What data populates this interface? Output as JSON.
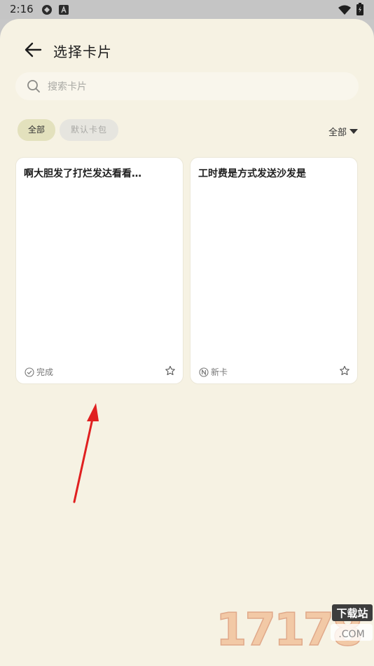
{
  "status_bar": {
    "time": "2:16"
  },
  "header": {
    "title": "选择卡片"
  },
  "search": {
    "placeholder": "搜索卡片"
  },
  "filters": {
    "chips": [
      "全部",
      "默认卡包"
    ],
    "sort_dropdown": "全部"
  },
  "cards": [
    {
      "title": "啊大胆发了打烂发达看看…",
      "status": "完成",
      "status_icon": "check-circle-icon"
    },
    {
      "title": "工时费是方式发送沙发是",
      "status": "新卡",
      "status_icon": "n-circle-icon"
    }
  ],
  "watermark": {
    "digits": "17178",
    "badge": "下载站",
    "suffix": ".COM"
  },
  "colors": {
    "background": "#f6f2e3",
    "card": "#ffffff",
    "active_chip": "#e3e1bd",
    "annotation_arrow": "#e02020"
  }
}
